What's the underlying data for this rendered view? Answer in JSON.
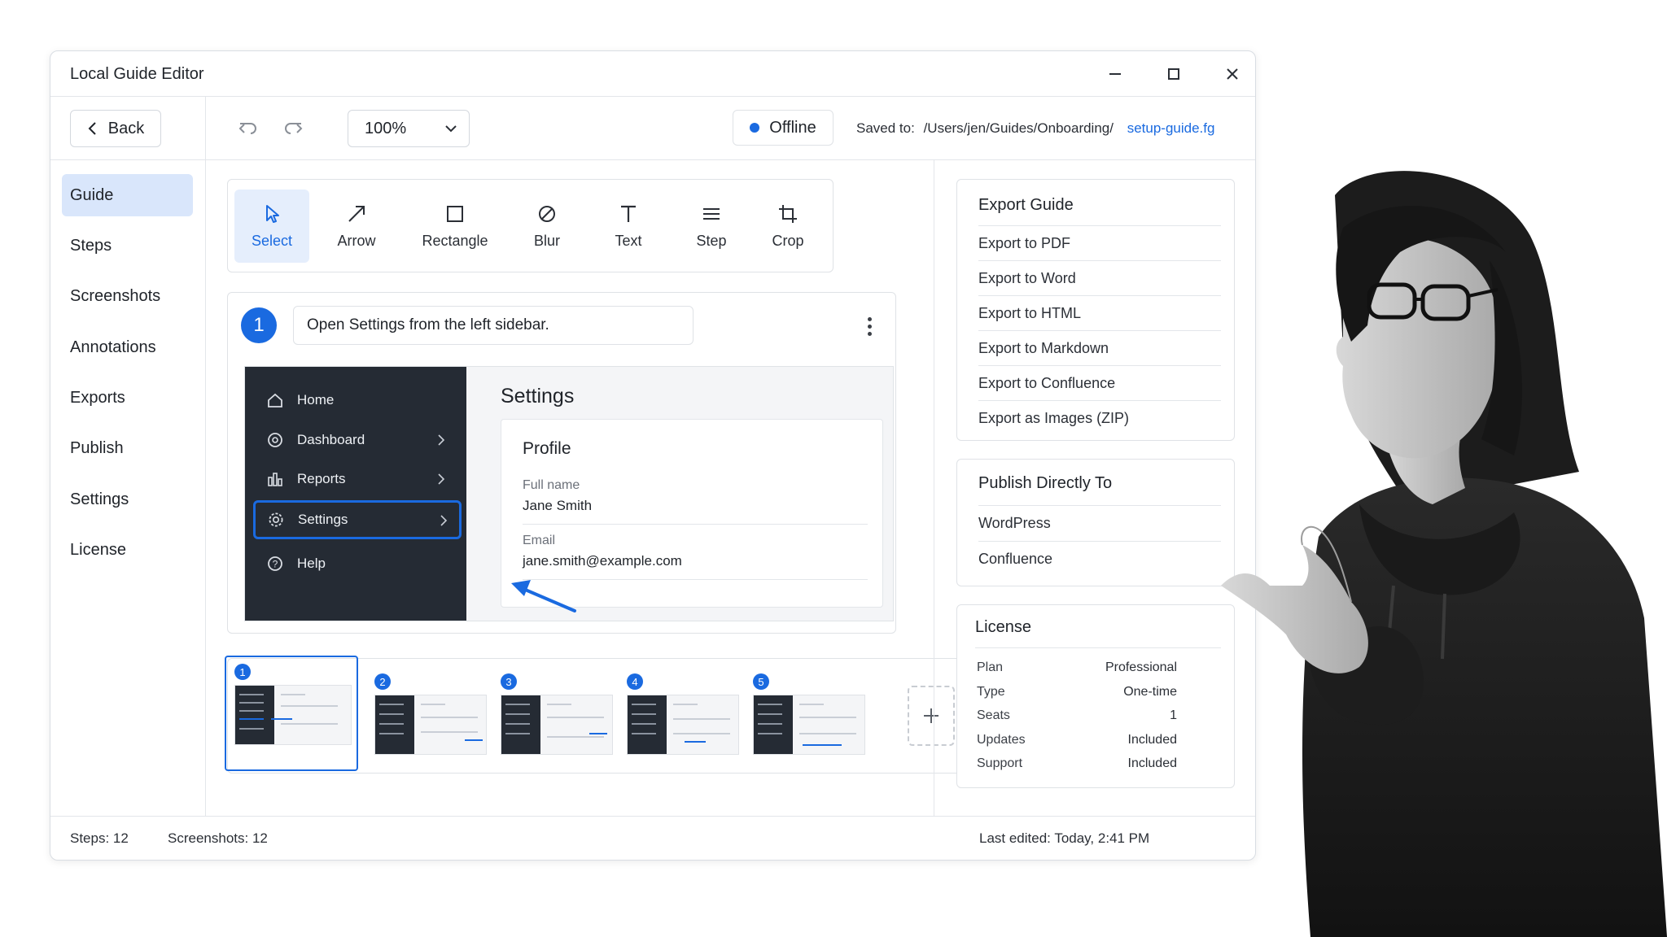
{
  "window": {
    "title": "Local Guide Editor"
  },
  "toolbar": {
    "back_label": "Back",
    "zoom": "100%",
    "status": "Offline",
    "saved_to_label": "Saved to:",
    "saved_path": "/Users/jen/Guides/Onboarding/",
    "saved_file": "setup-guide.fg"
  },
  "nav": {
    "items": [
      {
        "label": "Guide",
        "active": true
      },
      {
        "label": "Steps"
      },
      {
        "label": "Screenshots"
      },
      {
        "label": "Annotations"
      },
      {
        "label": "Exports"
      },
      {
        "label": "Publish"
      },
      {
        "label": "Settings"
      },
      {
        "label": "License"
      }
    ]
  },
  "tools": [
    {
      "label": "Select",
      "icon": "cursor-icon",
      "active": true
    },
    {
      "label": "Arrow",
      "icon": "arrow-icon"
    },
    {
      "label": "Rectangle",
      "icon": "rectangle-icon"
    },
    {
      "label": "Blur",
      "icon": "blur-icon"
    },
    {
      "label": "Text",
      "icon": "text-icon"
    },
    {
      "label": "Step",
      "icon": "step-icon"
    },
    {
      "label": "Crop",
      "icon": "crop-icon"
    }
  ],
  "step": {
    "number": "1",
    "instruction": "Open Settings from the left sidebar.",
    "screenshot": {
      "sidebar": [
        {
          "label": "Home",
          "icon": "home-icon"
        },
        {
          "label": "Dashboard",
          "icon": "dashboard-icon"
        },
        {
          "label": "Reports",
          "icon": "reports-icon"
        },
        {
          "label": "Settings",
          "icon": "gear-icon"
        },
        {
          "label": "Help",
          "icon": "help-icon"
        }
      ],
      "heading": "Settings",
      "profile": {
        "title": "Profile",
        "full_name_label": "Full name",
        "full_name": "Jane Smith",
        "email_label": "Email",
        "email": "jane.smith@example.com"
      }
    }
  },
  "filmstrip": {
    "thumbs": [
      "1",
      "2",
      "3",
      "4",
      "5"
    ],
    "selected": "1"
  },
  "export_panel": {
    "title": "Export Guide",
    "items": [
      "Export to PDF",
      "Export to Word",
      "Export to HTML",
      "Export to Markdown",
      "Export to Confluence",
      "Export as Images (ZIP)"
    ]
  },
  "publish_panel": {
    "title": "Publish Directly To",
    "items": [
      "WordPress",
      "Confluence"
    ]
  },
  "license_panel": {
    "title": "License",
    "rows": [
      {
        "key": "Plan",
        "value": "Professional"
      },
      {
        "key": "Type",
        "value": "One-time"
      },
      {
        "key": "Seats",
        "value": "1"
      },
      {
        "key": "Updates",
        "value": "Included"
      },
      {
        "key": "Support",
        "value": "Included"
      }
    ]
  },
  "statusbar": {
    "steps": "Steps: 12",
    "screenshots": "Screenshots: 12",
    "last_edited": "Last edited: Today, 2:41 PM"
  },
  "colors": {
    "accent": "#1a6ae0",
    "nav_active_bg": "#d9e6fb",
    "dark_sidebar": "#252b34"
  }
}
